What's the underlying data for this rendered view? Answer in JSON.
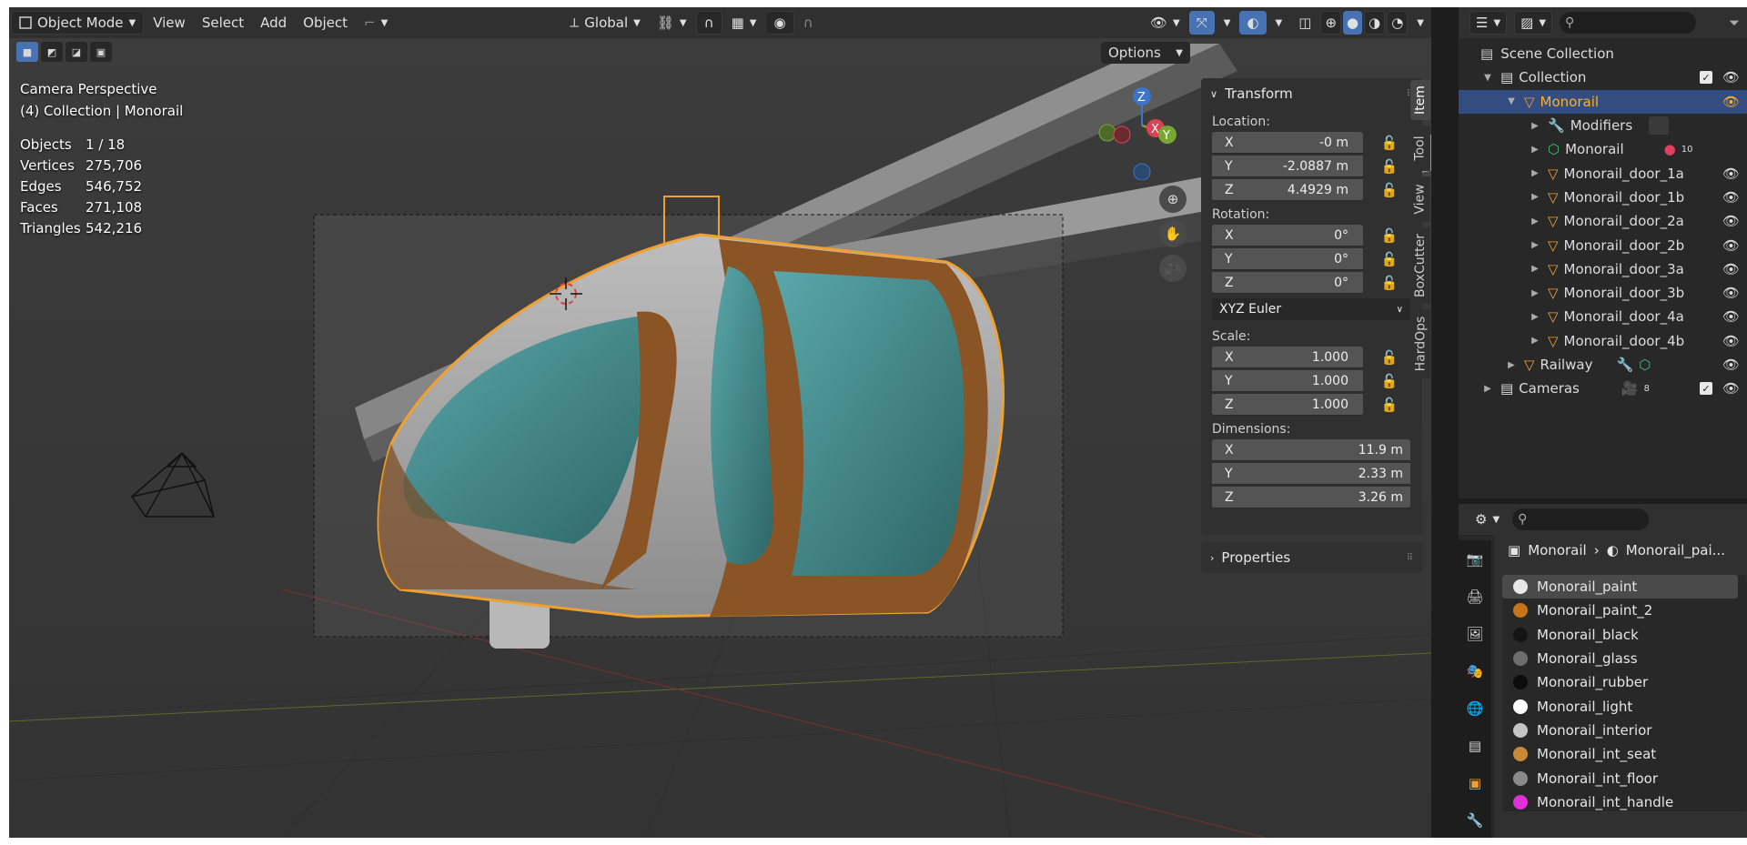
{
  "header": {
    "mode": "Object Mode",
    "menus": [
      "View",
      "Select",
      "Add",
      "Object"
    ],
    "orientation": "Global",
    "options": "Options"
  },
  "overlay": {
    "view_name": "Camera Perspective",
    "collection_info": "(4) Collection | Monorail",
    "stats": [
      {
        "label": "Objects",
        "value": "1 / 18"
      },
      {
        "label": "Vertices",
        "value": "275,706"
      },
      {
        "label": "Edges",
        "value": "546,752"
      },
      {
        "label": "Faces",
        "value": "271,108"
      },
      {
        "label": "Triangles",
        "value": "542,216"
      }
    ]
  },
  "gizmo": {
    "x": "X",
    "y": "Y",
    "z": "Z"
  },
  "npanel": {
    "transform_title": "Transform",
    "location_label": "Location:",
    "location": [
      {
        "axis": "X",
        "value": "-0 m"
      },
      {
        "axis": "Y",
        "value": "-2.0887 m"
      },
      {
        "axis": "Z",
        "value": "4.4929 m"
      }
    ],
    "rotation_label": "Rotation:",
    "rotation": [
      {
        "axis": "X",
        "value": "0°"
      },
      {
        "axis": "Y",
        "value": "0°"
      },
      {
        "axis": "Z",
        "value": "0°"
      }
    ],
    "rotation_mode": "XYZ Euler",
    "scale_label": "Scale:",
    "scale": [
      {
        "axis": "X",
        "value": "1.000"
      },
      {
        "axis": "Y",
        "value": "1.000"
      },
      {
        "axis": "Z",
        "value": "1.000"
      }
    ],
    "dimensions_label": "Dimensions:",
    "dimensions": [
      {
        "axis": "X",
        "value": "11.9 m"
      },
      {
        "axis": "Y",
        "value": "2.33 m"
      },
      {
        "axis": "Z",
        "value": "3.26 m"
      }
    ],
    "properties_title": "Properties",
    "tabs": [
      "Item",
      "Tool",
      "View",
      "BoxCutter",
      "HardOps"
    ]
  },
  "outliner": {
    "scene_collection": "Scene Collection",
    "collection": "Collection",
    "monorail": "Monorail",
    "modifiers": "Modifiers",
    "mesh": "Monorail",
    "mesh_badge": "10",
    "doors": [
      "Monorail_door_1a",
      "Monorail_door_1b",
      "Monorail_door_2a",
      "Monorail_door_2b",
      "Monorail_door_3a",
      "Monorail_door_3b",
      "Monorail_door_4a",
      "Monorail_door_4b"
    ],
    "railway": "Railway",
    "cameras": "Cameras",
    "cameras_badge": "8"
  },
  "properties": {
    "breadcrumb_object": "Monorail",
    "breadcrumb_material": "Monorail_pai...",
    "materials": [
      {
        "name": "Monorail_paint",
        "color": "#e8e8e8"
      },
      {
        "name": "Monorail_paint_2",
        "color": "#c8741a"
      },
      {
        "name": "Monorail_black",
        "color": "#151515"
      },
      {
        "name": "Monorail_glass",
        "color": "#6e6e6e"
      },
      {
        "name": "Monorail_rubber",
        "color": "#0c0c0c"
      },
      {
        "name": "Monorail_light",
        "color": "#ffffff"
      },
      {
        "name": "Monorail_interior",
        "color": "#c4c4c4"
      },
      {
        "name": "Monorail_int_seat",
        "color": "#c88a3a"
      },
      {
        "name": "Monorail_int_floor",
        "color": "#8a8a8a"
      },
      {
        "name": "Monorail_int_handle",
        "color": "#e030d8"
      }
    ]
  },
  "colors": {
    "accent": "#4772b3",
    "selection": "#ffaf29",
    "outline": "#f0a030"
  }
}
